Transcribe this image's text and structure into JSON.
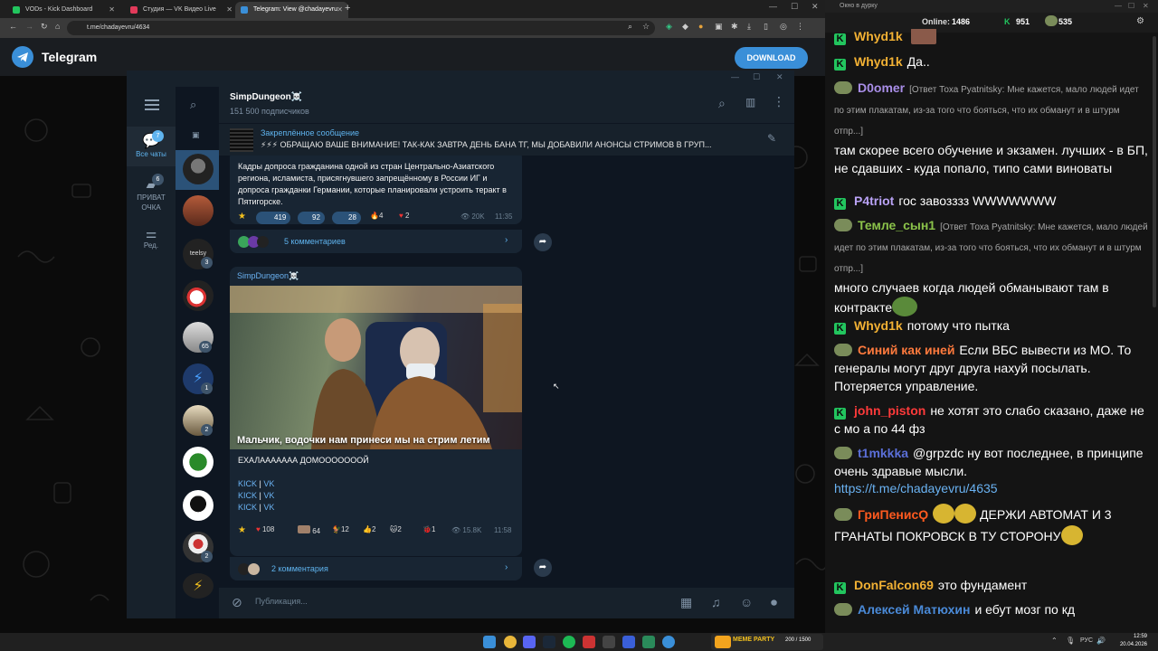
{
  "browser": {
    "tabs": [
      {
        "label": "VODs - Kick Dashboard",
        "active": false,
        "color": "#22c55e"
      },
      {
        "label": "Студия — VK Видео Live",
        "active": false,
        "color": "#e23a5a"
      },
      {
        "label": "Telegram: View @chadayevru",
        "active": true,
        "color": "#3a8fd8"
      }
    ],
    "url": "t.me/chadayevru/4634"
  },
  "tg_header": {
    "title": "Telegram",
    "download_label": "DOWNLOAD"
  },
  "app": {
    "folders": [
      {
        "label": "Все чаты",
        "badge": "7",
        "active": true
      },
      {
        "label": "ПРИВАТ ОЧКА",
        "badge": "6",
        "active": false
      },
      {
        "label": "Ред.",
        "badge": "",
        "active": false
      }
    ],
    "chat_badges": [
      "3",
      "65",
      "1",
      "2",
      "2"
    ],
    "channel": {
      "name": "SimpDungeon☠️",
      "subscribers": "151 500 подписчиков"
    },
    "pinned": {
      "title": "Закреплённое сообщение",
      "text": "⚡⚡⚡ ОБРАЩАЮ ВАШЕ ВНИМАНИЕ! ТАК-КАК ЗАВТРА ДЕНЬ БАНА ТГ, МЫ ДОБАВИЛИ АНОНСЫ СТРИМОВ В ГРУП..."
    },
    "msg1": {
      "text": "Кадры допроса гражданина одной из стран Центрально-Азиатского региона, исламиста, присягнувшего запрещённому в России ИГ и допроса гражданки Германии, которые планировали устроить теракт в Пятигорске.",
      "reactions": [
        "419",
        "92",
        "28",
        "4",
        "2"
      ],
      "views": "20K",
      "time": "11:35",
      "comments": "5 комментариев"
    },
    "msg2": {
      "author": "SimpDungeon☠️",
      "caption": "Мальчик, водочки нам принеси  мы на стрим летим",
      "text": "ЕХАЛААААААА ДОМООООООOЙ",
      "links": [
        {
          "a": "KICK",
          "b": "VK"
        },
        {
          "a": "KICK",
          "b": "VK"
        },
        {
          "a": "KICK",
          "b": "VK"
        }
      ],
      "reactions": [
        "108",
        "64",
        "12",
        "2",
        "2",
        "1"
      ],
      "views": "15.8K",
      "time": "11:58",
      "comments": "2 комментария"
    },
    "composer_placeholder": "Публикация..."
  },
  "side_chat": {
    "window_title": "Окно в дурку",
    "online_label": "Online:",
    "online_count": "1486",
    "kick_count": "951",
    "other_count": "535",
    "messages": [
      {
        "badge": "kick",
        "user": "Whyd1k",
        "color": "#f2b134",
        "reply": "",
        "text": ""
      },
      {
        "badge": "kick",
        "user": "Whyd1k",
        "color": "#f2b134",
        "reply": "",
        "text": "Да.."
      },
      {
        "badge": "frog",
        "user": "D0omer",
        "color": "#a98ee8",
        "reply": "[Ответ Тоха Pyatnitsky: Мне кажется, мало людей идет по этим плакатам, из-за того что бояться, что их обманут и в штурм отпр...]",
        "text": "там скорее всего обучение и экзамен. лучших - в БП, не сдавших - куда попало, типо сами виноваты"
      },
      {
        "badge": "kick",
        "user": "P4triot",
        "color": "#b9a2f5",
        "reply": "",
        "text": "гос завозззз WWWWWWW"
      },
      {
        "badge": "frog",
        "user": "Темле_сын1",
        "color": "#8bc34a",
        "reply": "[Ответ Тоха Pyatnitsky: Мне кажется, мало людей идет по этим плакатам, из-за того что бояться, что их обманут и в штурм отпр...]",
        "text": "много случаев когда людей обманывают там в контракте"
      },
      {
        "badge": "kick",
        "user": "Whyd1k",
        "color": "#f2b134",
        "reply": "",
        "text": "потому что пытка"
      },
      {
        "badge": "frog",
        "user": "Синий как иней",
        "color": "#ff7a3d",
        "reply": "",
        "text": "Если ВБС вывести из МО. То генералы могут друг друга нахуй посылать. Потеряется управление."
      },
      {
        "badge": "kick",
        "user": "john_piston",
        "color": "#ff3a3a",
        "reply": "",
        "text": "не хотят это слабо сказано, даже не с мо а по 44 фз"
      },
      {
        "badge": "frog",
        "user": "t1mkkka",
        "color": "#5b6fd8",
        "reply": "",
        "text": "@grpzdc ну вот последнее, в принципе очень здравые мысли."
      },
      {
        "badge": "link",
        "user": "",
        "color": "",
        "reply": "",
        "text": "https://t.me/chadayevru/4635"
      },
      {
        "badge": "frog",
        "user": "ГриПенисϘ",
        "color": "#ff5a1f",
        "reply": "",
        "text": "ДЕРЖИ АВТОМАТ И 3 ГРАНАТЫ ПОКРОВСК В ТУ СТОРОНУ"
      },
      {
        "badge": "kick",
        "user": "DonFalcon69",
        "color": "#f2b134",
        "reply": "",
        "text": "это фундамент"
      },
      {
        "badge": "frog",
        "user": "Алексей Матюхин",
        "color": "#4a8ad8",
        "reply": "",
        "text": "и ебут мозг по кд"
      }
    ]
  },
  "taskbar": {
    "party_label": "MEME PARTY",
    "party_count": "200 / 1500",
    "lang": "РУС",
    "time": "12:59",
    "date": "20.04.2026"
  }
}
